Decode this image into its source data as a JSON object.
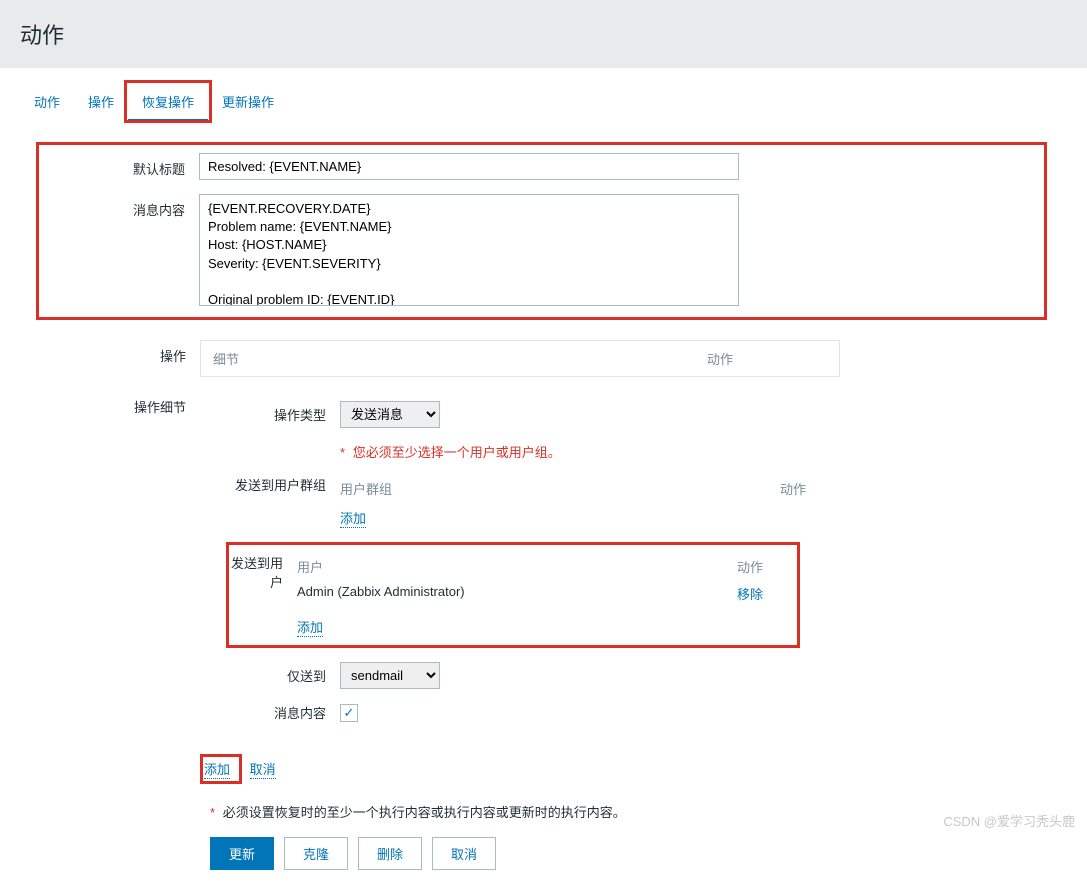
{
  "header": {
    "title": "动作"
  },
  "tabs": {
    "items": [
      "动作",
      "操作",
      "恢复操作",
      "更新操作"
    ],
    "activeIndex": 2
  },
  "form": {
    "defaultTitle": {
      "label": "默认标题",
      "value": "Resolved: {EVENT.NAME}"
    },
    "messageContent": {
      "label": "消息内容",
      "value": "{EVENT.RECOVERY.DATE}\nProblem name: {EVENT.NAME}\nHost: {HOST.NAME}\nSeverity: {EVENT.SEVERITY}\n\nOriginal problem ID: {EVENT.ID}\n{TRIGGER.URL}"
    }
  },
  "operations": {
    "label": "操作",
    "headers": {
      "detail": "细节",
      "action": "动作"
    }
  },
  "details": {
    "label": "操作细节",
    "type": {
      "label": "操作类型",
      "value": "发送消息"
    },
    "hint": "您必须至少选择一个用户或用户组。",
    "userGroups": {
      "label": "发送到用户群组",
      "headers": {
        "group": "用户群组",
        "action": "动作"
      },
      "add": "添加"
    },
    "users": {
      "label": "发送到用户",
      "headers": {
        "user": "用户",
        "action": "动作"
      },
      "rows": [
        {
          "name": "Admin (Zabbix Administrator)",
          "remove": "移除"
        }
      ],
      "add": "添加"
    },
    "sendOnly": {
      "label": "仅送到",
      "value": "sendmail"
    },
    "msgContent": {
      "label": "消息内容",
      "checked": true
    }
  },
  "actionLinks": {
    "add": "添加",
    "cancel": "取消"
  },
  "note": "必须设置恢复时的至少一个执行内容或执行内容或更新时的执行内容。",
  "buttons": {
    "update": "更新",
    "clone": "克隆",
    "delete": "删除",
    "cancel": "取消"
  },
  "watermark": "CSDN @爱学习秃头鹿"
}
